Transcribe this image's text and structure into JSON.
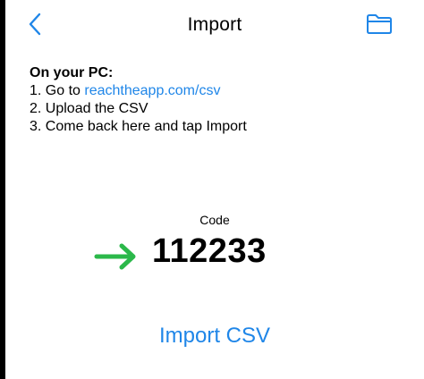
{
  "nav": {
    "title": "Import",
    "back_icon": "chevron-left-icon",
    "folder_icon": "folder-icon"
  },
  "instructions": {
    "heading": "On your PC:",
    "step1_prefix": "1. Go to ",
    "step1_link": "reachtheapp.com/csv",
    "step2": "2. Upload the CSV",
    "step3": "3. Come back here and tap Import"
  },
  "code": {
    "label": "Code",
    "value": "112233",
    "arrow_icon": "arrow-right-icon",
    "arrow_color": "#2bb84a"
  },
  "import_button": {
    "label": "Import CSV"
  },
  "colors": {
    "accent": "#1f86e8",
    "text": "#000000",
    "background": "#ffffff"
  }
}
